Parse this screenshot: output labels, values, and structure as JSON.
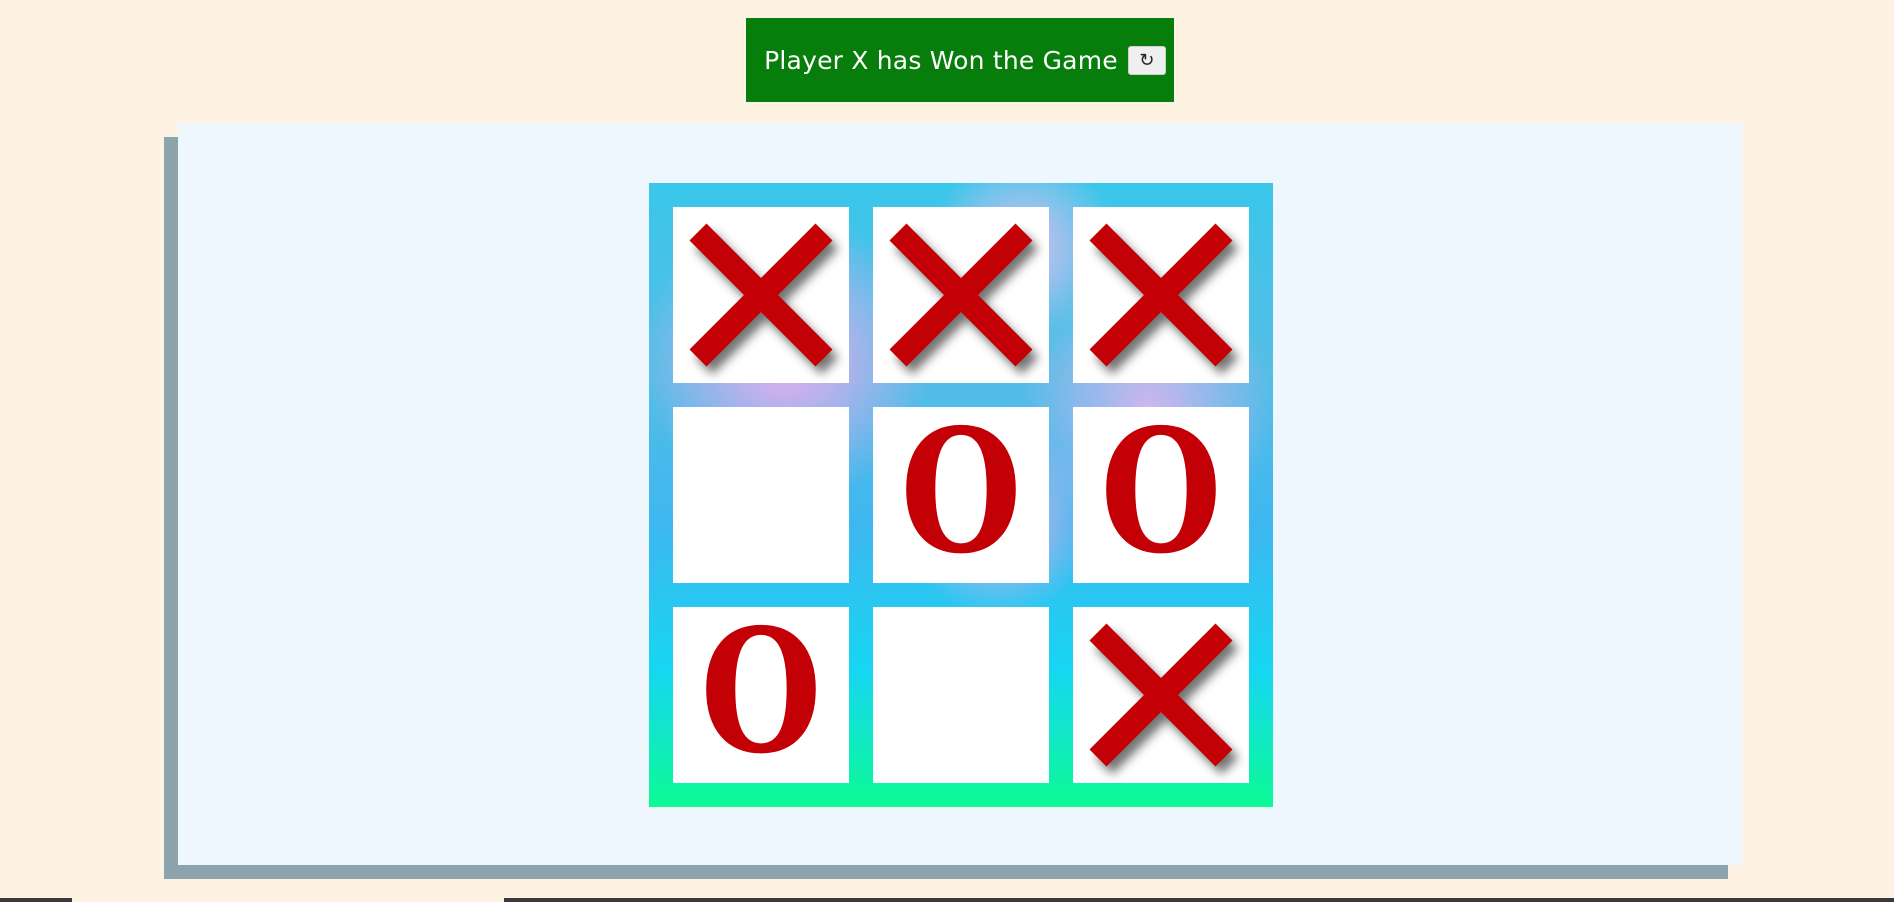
{
  "status": {
    "message": "Player X has Won the Game",
    "reset_label": "↻",
    "banner_color": "#077d0b"
  },
  "board": {
    "cells": [
      "X",
      "X",
      "X",
      "",
      "O",
      "O",
      "O",
      "",
      "X"
    ],
    "mark_color": "#c30005"
  },
  "colors": {
    "page_background": "#fef3e3",
    "panel_background": "#eef7fe",
    "panel_shadow": "#8ea4ad"
  }
}
